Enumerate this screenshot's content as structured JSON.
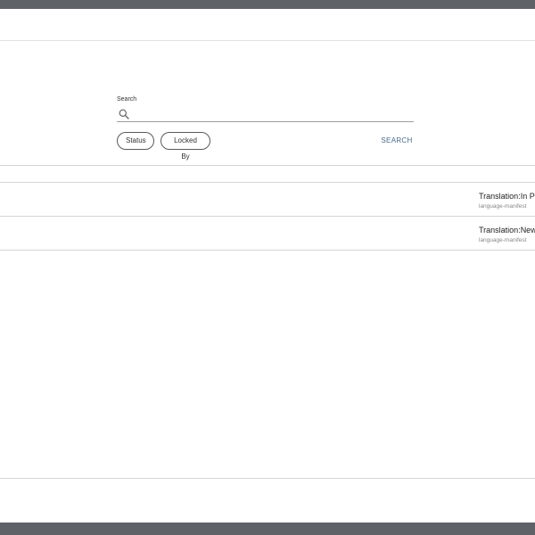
{
  "search": {
    "label": "Search",
    "value": "",
    "placeholder": ""
  },
  "filters": [
    {
      "label": "Status"
    },
    {
      "label": "Locked By"
    }
  ],
  "search_button_label": "SEARCH",
  "items": [
    {
      "title": "Translation:In Progress",
      "subtitle": "language-manifest"
    },
    {
      "title": "Translation:New",
      "subtitle": "language-manifest"
    }
  ],
  "colors": {
    "frame": "#5f6368",
    "accent": "#4a6a8a",
    "divider": "#d5d5d5"
  }
}
